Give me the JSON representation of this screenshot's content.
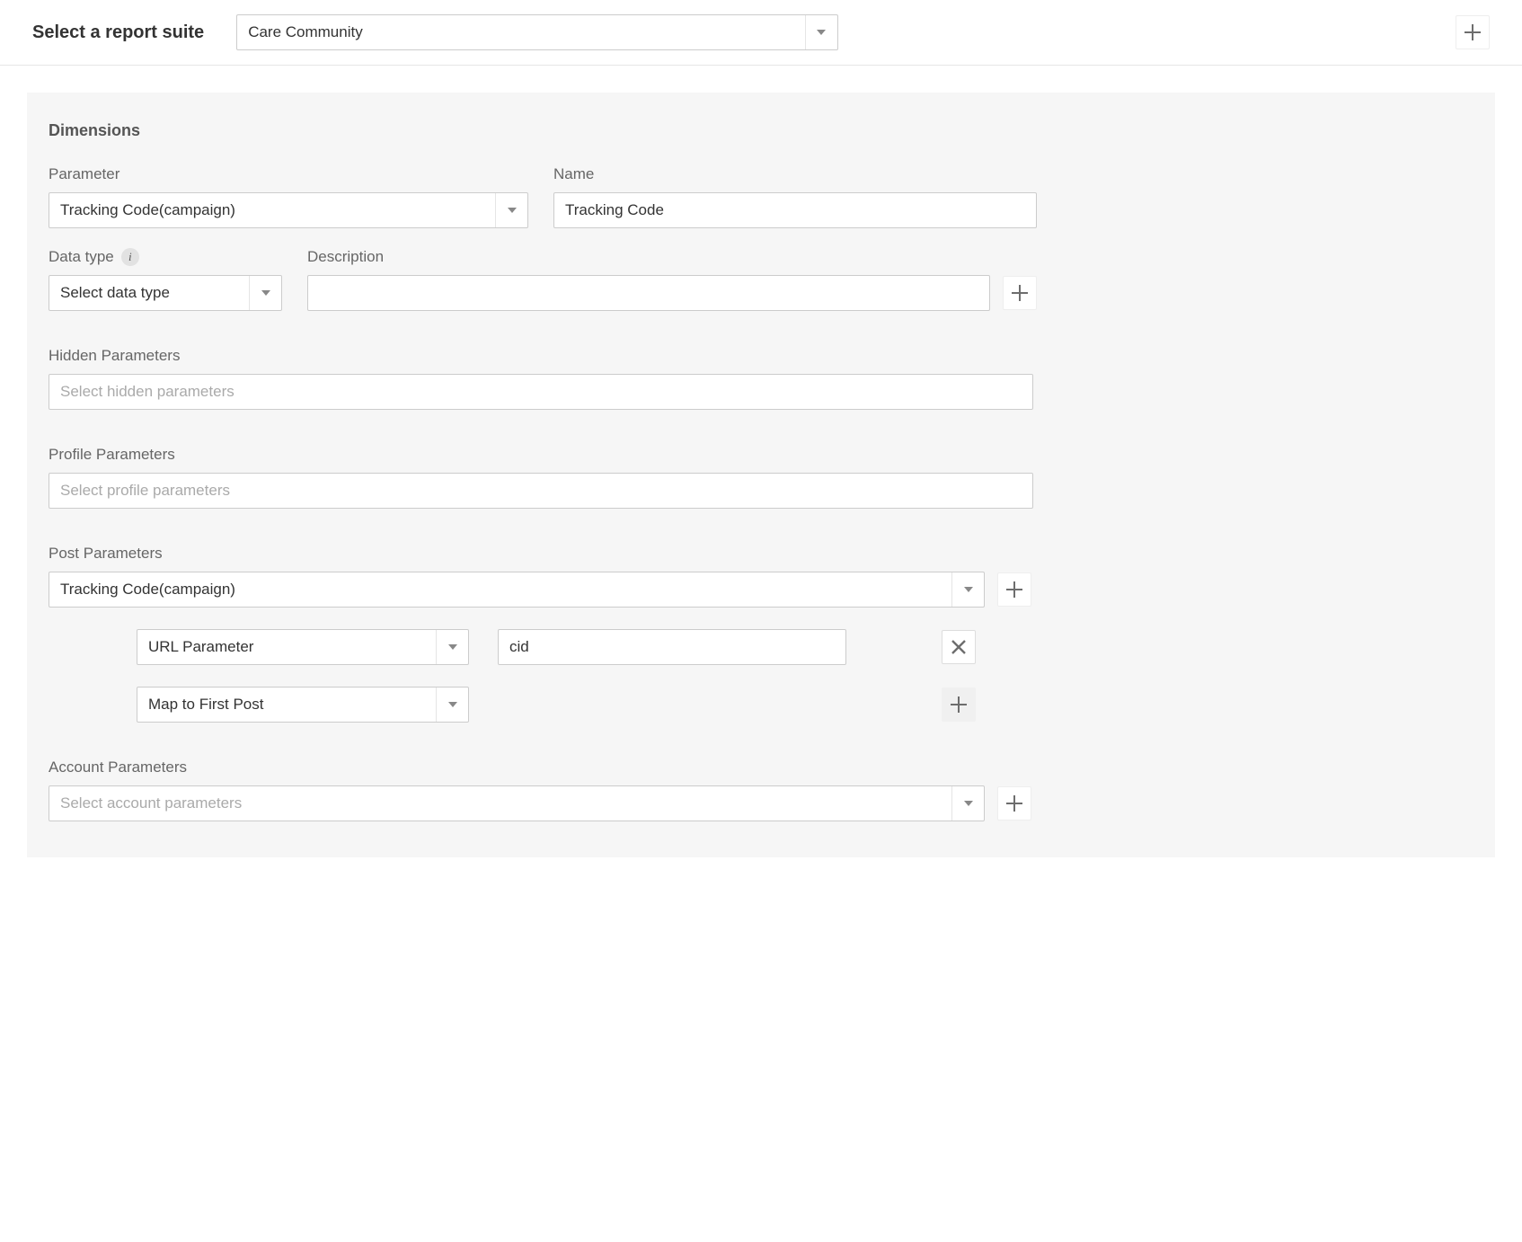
{
  "topbar": {
    "label": "Select a report suite",
    "suite_selected": "Care Community"
  },
  "dimensions": {
    "title": "Dimensions",
    "parameter_label": "Parameter",
    "parameter_value": "Tracking Code(campaign)",
    "name_label": "Name",
    "name_value": "Tracking Code",
    "datatype_label": "Data type",
    "datatype_value": "Select data type",
    "description_label": "Description",
    "description_value": ""
  },
  "hidden": {
    "label": "Hidden Parameters",
    "placeholder": "Select hidden parameters"
  },
  "profile": {
    "label": "Profile Parameters",
    "placeholder": "Select profile parameters"
  },
  "post": {
    "label": "Post Parameters",
    "selected": "Tracking Code(campaign)",
    "rule_type": "URL Parameter",
    "rule_value": "cid",
    "map_value": "Map to First Post"
  },
  "account": {
    "label": "Account Parameters",
    "placeholder": "Select account parameters"
  }
}
